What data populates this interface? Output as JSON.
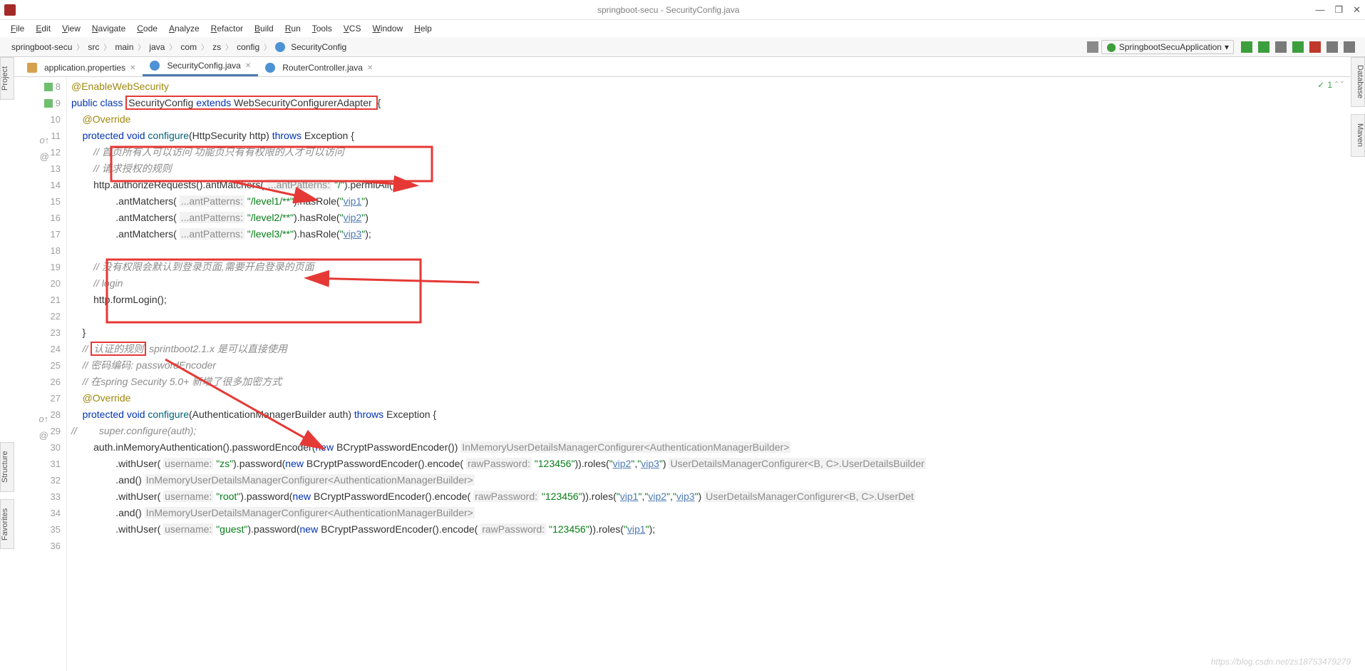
{
  "window": {
    "title": "springboot-secu - SecurityConfig.java"
  },
  "menu": [
    "File",
    "Edit",
    "View",
    "Navigate",
    "Code",
    "Analyze",
    "Refactor",
    "Build",
    "Run",
    "Tools",
    "VCS",
    "Window",
    "Help"
  ],
  "breadcrumb": [
    "springboot-secu",
    "src",
    "main",
    "java",
    "com",
    "zs",
    "config",
    "SecurityConfig"
  ],
  "run_config": "SpringbootSecuApplication",
  "tabs": [
    {
      "label": "application.properties",
      "active": false
    },
    {
      "label": "SecurityConfig.java",
      "active": true
    },
    {
      "label": "RouterController.java",
      "active": false
    }
  ],
  "side": {
    "project": "Project",
    "structure": "Structure",
    "favorites": "Favorites",
    "database": "Database",
    "maven": "Maven"
  },
  "editor_status": {
    "check": "✓",
    "count": "1"
  },
  "gutter_start": 8,
  "code_lines": [
    {
      "n": 8,
      "icon": "leaf",
      "html": "<span class='anno'>@EnableWebSecurity</span>"
    },
    {
      "n": 9,
      "icon": "leaf",
      "html": "<span class='kw'>public class</span> <span style='border:2px solid #e53935;padding:0 2px'>SecurityConfig <span class='kw'>extends</span> WebSecurityConfigurerAdapter </span>{"
    },
    {
      "n": 10,
      "html": "    <span class='anno'>@Override</span>"
    },
    {
      "n": 11,
      "icon": "o",
      "html": "    <span class='kw'>protected void</span> <span class='mtd'>configure</span>(HttpSecurity http) <span class='kw'>throws</span> Exception {"
    },
    {
      "n": 12,
      "html": "        <span class='cmt'>// 首页所有人可以访问 功能页只有有权限的人才可以访问</span>"
    },
    {
      "n": 13,
      "html": "        <span class='cmt'>// 请求授权的规则</span>"
    },
    {
      "n": 14,
      "html": "        http.authorizeRequests().antMatchers( <span class='hint'>...antPatterns:</span> <span class='str'>\"/\"</span>).permitAll()"
    },
    {
      "n": 15,
      "html": "                .antMatchers( <span class='hint'>...antPatterns:</span> <span class='str'>\"/level1/**\"</span>).hasRole(<span class='str'>\"<span class='link'>vip1</span>\"</span>)"
    },
    {
      "n": 16,
      "html": "                .antMatchers( <span class='hint'>...antPatterns:</span> <span class='str'>\"/level2/**\"</span>).hasRole(<span class='str'>\"<span class='link'>vip2</span>\"</span>)"
    },
    {
      "n": 17,
      "html": "                .antMatchers( <span class='hint'>...antPatterns:</span> <span class='str'>\"/level3/**\"</span>).hasRole(<span class='str'>\"<span class='link'>vip3</span>\"</span>);"
    },
    {
      "n": 18,
      "html": ""
    },
    {
      "n": 19,
      "html": "        <span class='cmt'>// 没有权限会默认到登录页面,需要开启登录的页面</span>"
    },
    {
      "n": 20,
      "html": "        <span class='cmt'>// login</span>"
    },
    {
      "n": 21,
      "html": "        http.formLogin();"
    },
    {
      "n": 22,
      "html": ""
    },
    {
      "n": 23,
      "html": "    }"
    },
    {
      "n": 24,
      "html": "    <span class='cmt'>// <span style='border:2px solid #e53935;padding:0 2px;font-style:italic'>认证的规则</span> sprintboot2.1.x 是可以直接使用</span>"
    },
    {
      "n": 25,
      "html": "    <span class='cmt'>// 密码编码: passwordEncoder</span>"
    },
    {
      "n": 26,
      "html": "    <span class='cmt'>// 在spring Security 5.0+ 新增了很多加密方式</span>"
    },
    {
      "n": 27,
      "html": "    <span class='anno'>@Override</span>"
    },
    {
      "n": 28,
      "icon": "o",
      "html": "    <span class='kw'>protected void</span> <span class='mtd'>configure</span>(AuthenticationManagerBuilder auth) <span class='kw'>throws</span> Exception {"
    },
    {
      "n": 29,
      "html": "<span class='cmt'>//        super.configure(auth);</span>"
    },
    {
      "n": 30,
      "html": "        auth.inMemoryAuthentication().passwordEncoder(<span class='kw'>new</span> BCryptPasswordEncoder()) <span class='hint'>InMemoryUserDetailsManagerConfigurer&lt;AuthenticationManagerBuilder&gt;</span>"
    },
    {
      "n": 31,
      "html": "                .withUser( <span class='hint'>username:</span> <span class='str'>\"zs\"</span>).password(<span class='kw'>new</span> BCryptPasswordEncoder().encode( <span class='hint'>rawPassword:</span> <span class='str'>\"123456\"</span>)).roles(<span class='str'>\"<span class='link'>vip2</span>\"</span>,<span class='str'>\"<span class='link'>vip3</span>\"</span>) <span class='hint'>UserDetailsManagerConfigurer&lt;B, C&gt;.UserDetailsBuilder</span>"
    },
    {
      "n": 32,
      "html": "                .and() <span class='hint'>InMemoryUserDetailsManagerConfigurer&lt;AuthenticationManagerBuilder&gt;</span>"
    },
    {
      "n": 33,
      "html": "                .withUser( <span class='hint'>username:</span> <span class='str'>\"root\"</span>).password(<span class='kw'>new</span> BCryptPasswordEncoder().encode( <span class='hint'>rawPassword:</span> <span class='str'>\"123456\"</span>)).roles(<span class='str'>\"<span class='link'>vip1</span>\"</span>,<span class='str'>\"<span class='link'>vip2</span>\"</span>,<span class='str'>\"<span class='link'>vip3</span>\"</span>) <span class='hint'>UserDetailsManagerConfigurer&lt;B, C&gt;.UserDet</span>"
    },
    {
      "n": 34,
      "html": "                .and() <span class='hint'>InMemoryUserDetailsManagerConfigurer&lt;AuthenticationManagerBuilder&gt;</span>"
    },
    {
      "n": 35,
      "html": "                .withUser( <span class='hint'>username:</span> <span class='str'>\"guest\"</span>).password(<span class='kw'>new</span> BCryptPasswordEncoder().encode( <span class='hint'>rawPassword:</span> <span class='str'>\"123456\"</span>)).roles(<span class='str'>\"<span class='link'>vip1</span>\"</span>);"
    },
    {
      "n": 36,
      "html": ""
    }
  ],
  "watermark": "https://blog.csdn.net/zs18753479279"
}
